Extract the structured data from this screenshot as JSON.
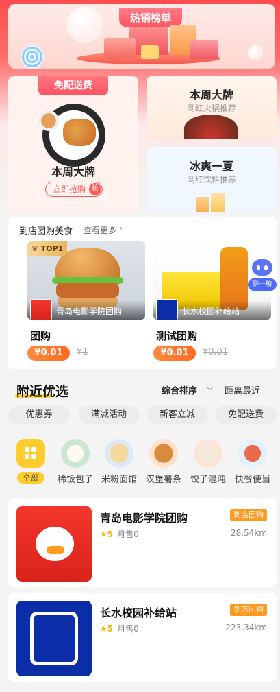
{
  "banner": {
    "tag": "热销榜单"
  },
  "promo": {
    "free_delivery": {
      "tag": "免配送费",
      "title": "本周大牌",
      "button": "立即抢购",
      "button_badge": "抢"
    },
    "hotpot": {
      "title": "本周大牌",
      "sub": "网红火锅推荐"
    },
    "cold": {
      "title": "冰爽一夏",
      "sub": "网红饮料推荐"
    }
  },
  "group_buy": {
    "heading": "到店团购美食",
    "more": "查看更多",
    "robot_label": "聊一聊",
    "items": [
      {
        "badge": "TOP1",
        "shop": "青岛电影学院团购",
        "name": "团购",
        "price": "¥0.01",
        "old_price": "¥1"
      },
      {
        "shop": "长水校园补给站",
        "name": "测试团购",
        "price": "¥0.01",
        "old_price": "¥0.01"
      }
    ]
  },
  "nearby": {
    "title": "附近优选",
    "sort_primary": "综合排序",
    "sort_secondary": "距离最近",
    "filters": [
      "优惠券",
      "满减活动",
      "新客立减",
      "免配送费"
    ],
    "categories": [
      "全部",
      "稀饭包子",
      "米粉面馆",
      "汉堡薯条",
      "饺子混沌",
      "快餐便当"
    ]
  },
  "shops": [
    {
      "name": "青岛电影学院团购",
      "tag": "到店团购",
      "rating": "5",
      "sales": "月售0",
      "distance": "28.54km"
    },
    {
      "name": "长水校园补给站",
      "tag": "到店团购",
      "rating": "5",
      "sales": "月售0",
      "distance": "223.34km"
    }
  ],
  "colors": {
    "accent": "#ff5a5a",
    "price": "#ff6a22",
    "highlight": "#ffcc2e",
    "tag": "#ff9a1f"
  }
}
